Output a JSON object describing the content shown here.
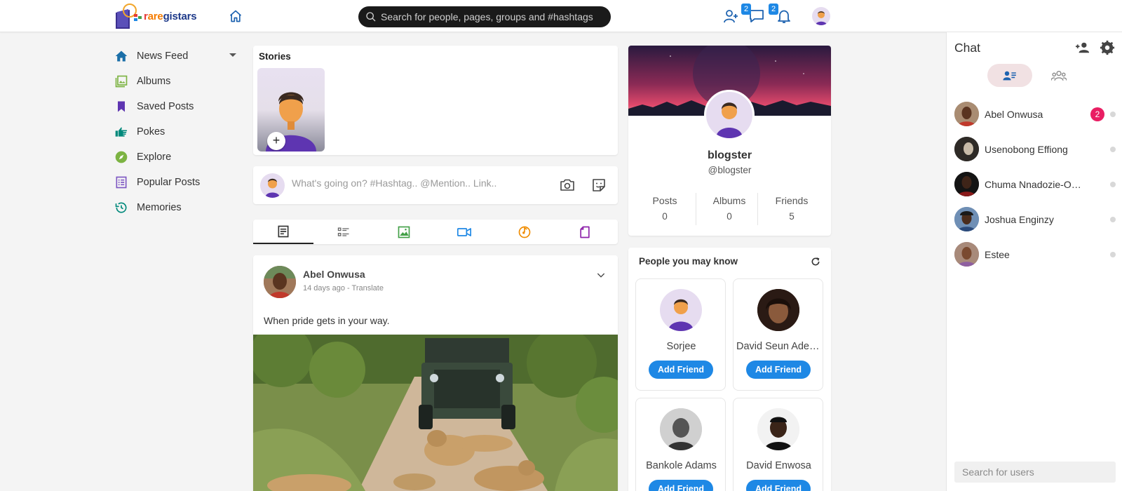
{
  "header": {
    "logo_text": "raregistars",
    "search_placeholder": "Search for people, pages, groups and #hashtags",
    "messages_badge": "2",
    "notifications_badge": "2"
  },
  "sidebar": {
    "items": [
      {
        "label": "News Feed",
        "icon": "home-icon",
        "color": "#1b6fa8"
      },
      {
        "label": "Albums",
        "icon": "albums-icon",
        "color": "#7cb342"
      },
      {
        "label": "Saved Posts",
        "icon": "bookmark-icon",
        "color": "#5e35b1"
      },
      {
        "label": "Pokes",
        "icon": "poke-icon",
        "color": "#00897b"
      },
      {
        "label": "Explore",
        "icon": "compass-icon",
        "color": "#7cb342"
      },
      {
        "label": "Popular Posts",
        "icon": "list-icon",
        "color": "#7e57c2"
      },
      {
        "label": "Memories",
        "icon": "history-icon",
        "color": "#00897b"
      }
    ]
  },
  "stories": {
    "title": "Stories",
    "add": "+"
  },
  "composer": {
    "placeholder": "What's going on? #Hashtag.. @Mention.. Link.."
  },
  "post": {
    "author": "Abel Onwusa",
    "meta": "14 days ago - Translate",
    "text": "When pride gets in your way."
  },
  "profile": {
    "name": "blogster",
    "handle": "@blogster",
    "stats": [
      {
        "label": "Posts",
        "value": "0"
      },
      {
        "label": "Albums",
        "value": "0"
      },
      {
        "label": "Friends",
        "value": "5"
      }
    ]
  },
  "pymk": {
    "title": "People you may know",
    "people": [
      {
        "name": "Sorjee",
        "button": "Add Friend"
      },
      {
        "name": "David Seun Adebayo",
        "button": "Add Friend"
      },
      {
        "name": "Bankole Adams",
        "button": "Add Friend"
      },
      {
        "name": "David Enwosa",
        "button": "Add Friend"
      }
    ]
  },
  "chat": {
    "title": "Chat",
    "contacts": [
      {
        "name": "Abel Onwusa",
        "badge": "2"
      },
      {
        "name": "Usenobong Effiong"
      },
      {
        "name": "Chuma Nnadozie-Onyekwere"
      },
      {
        "name": "Joshua Enginzy"
      },
      {
        "name": "Estee"
      }
    ],
    "search_placeholder": "Search for users"
  },
  "colors": {
    "accent": "#1e88e5",
    "badge": "#e91e63",
    "search_bg": "#1a1a1a"
  }
}
